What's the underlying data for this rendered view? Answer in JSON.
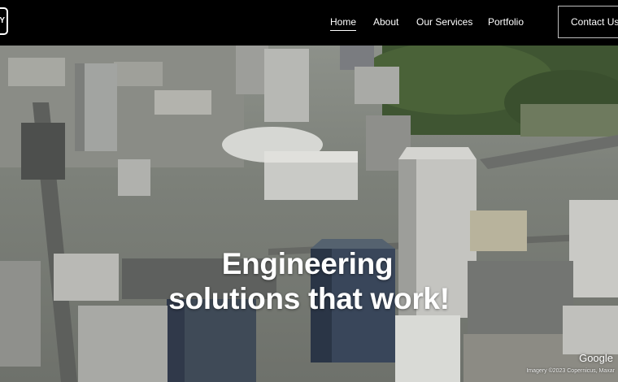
{
  "brand": {
    "logo_text": "AY"
  },
  "nav": {
    "items": [
      {
        "label": "Home",
        "active": true
      },
      {
        "label": "About",
        "active": false
      },
      {
        "label": "Our Services",
        "active": false
      },
      {
        "label": "Portfolio",
        "active": false
      }
    ],
    "contact_label": "Contact Us"
  },
  "hero": {
    "headline_line1": "Engineering",
    "headline_line2": "solutions that work!",
    "map_watermark": "Google",
    "map_attribution": "Imagery ©2023 Copernicus, Maxar"
  },
  "colors": {
    "nav_background": "#000000",
    "text": "#ffffff",
    "contact_border": "#bdbdbd"
  }
}
